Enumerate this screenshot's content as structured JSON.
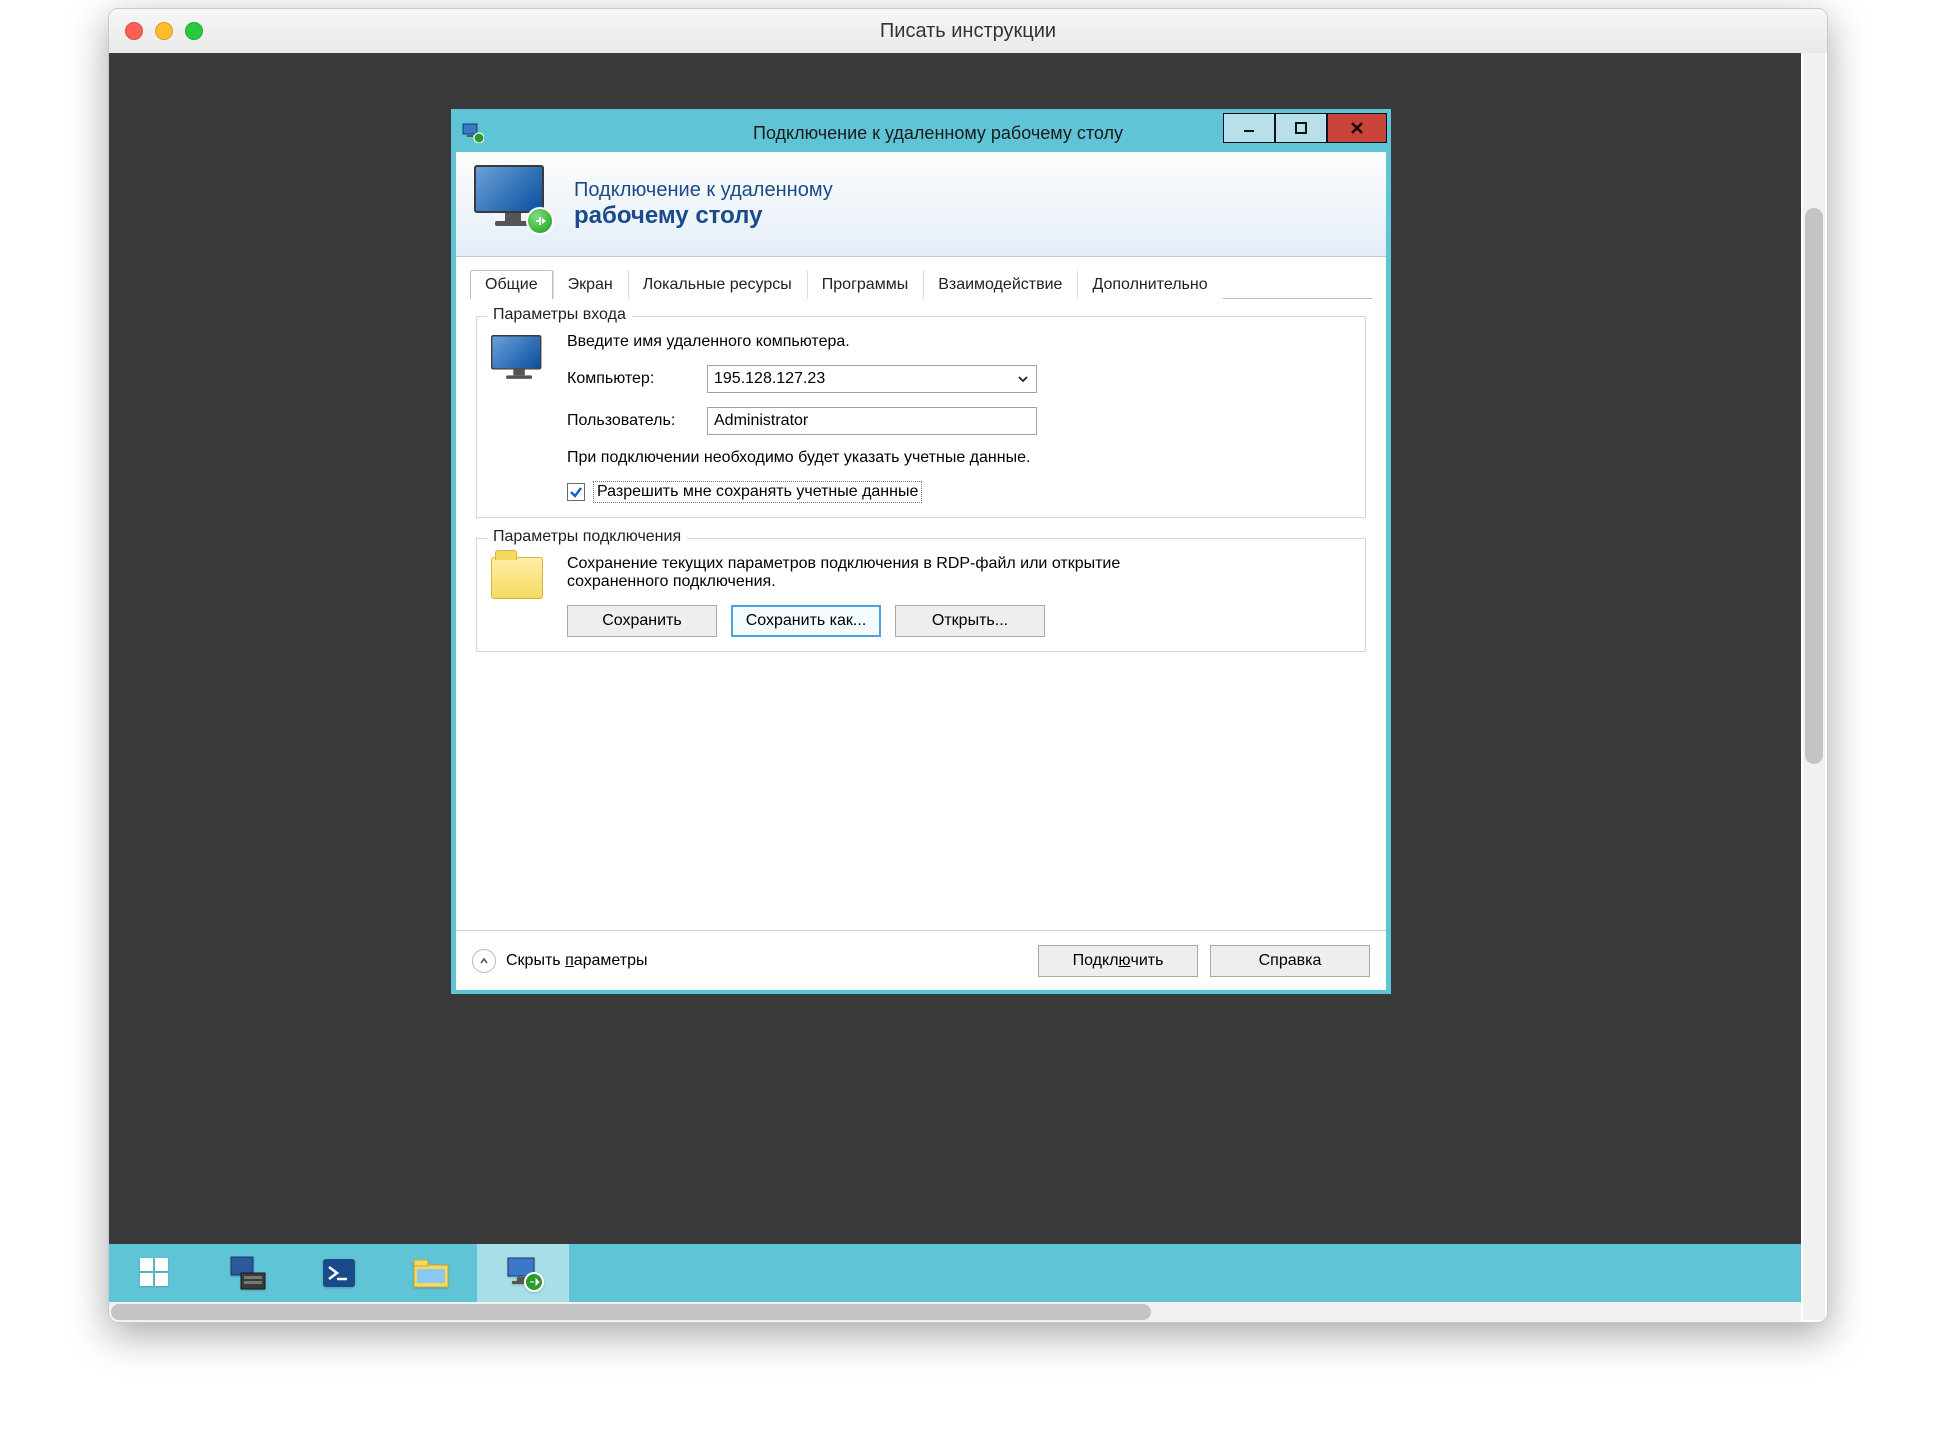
{
  "mac": {
    "title": "Писать инструкции"
  },
  "rdp": {
    "title": "Подключение к удаленному рабочему столу",
    "header_line1": "Подключение к удаленному",
    "header_line2": "рабочему столу",
    "tabs": {
      "general": "Общие",
      "screen": "Экран",
      "local": "Локальные ресурсы",
      "programs": "Программы",
      "experience": "Взаимодействие",
      "advanced": "Дополнительно"
    },
    "login_group": {
      "title": "Параметры входа",
      "intro": "Введите имя удаленного компьютера.",
      "computer_label": "Компьютер:",
      "computer_value": "195.128.127.23",
      "user_label": "Пользователь:",
      "user_value": "Administrator",
      "note": "При подключении необходимо будет указать учетные данные.",
      "save_creds_label": "Разрешить мне сохранять учетные данные"
    },
    "conn_group": {
      "title": "Параметры подключения",
      "desc": "Сохранение текущих параметров подключения в RDP-файл или открытие сохраненного подключения.",
      "save": "Сохранить",
      "save_as": "Сохранить как...",
      "open": "Открыть..."
    },
    "footer": {
      "hide_params_pre": "Скрыть ",
      "hide_params_ul": "п",
      "hide_params_post": "араметры",
      "connect_pre": "Подкл",
      "connect_ul": "ю",
      "connect_post": "чить",
      "help": "Справка"
    }
  }
}
